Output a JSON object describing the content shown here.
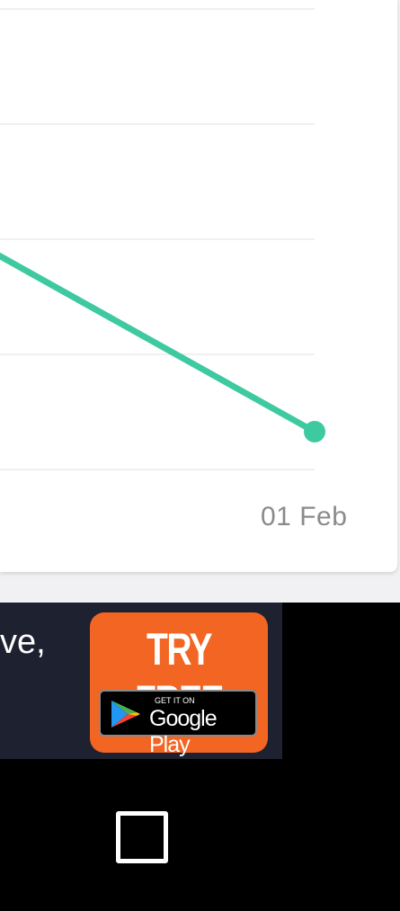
{
  "chart_data": {
    "type": "line",
    "x": [
      "",
      "01 Feb"
    ],
    "series": [
      {
        "values": [
          null,
          null
        ]
      }
    ],
    "tick_labels_x": [
      "01 Feb"
    ],
    "grid": true,
    "colors": {
      "line": "#3ec9a0",
      "grid": "#ebebeb"
    }
  },
  "ad": {
    "text": "ve,",
    "cta_label": "TRY FREE",
    "badge_small": "GET IT ON",
    "badge_store": "Google Play",
    "colors": {
      "banner": "#1e2130",
      "cta": "#f26522"
    }
  },
  "nav": {
    "recents_icon": "square-icon"
  }
}
